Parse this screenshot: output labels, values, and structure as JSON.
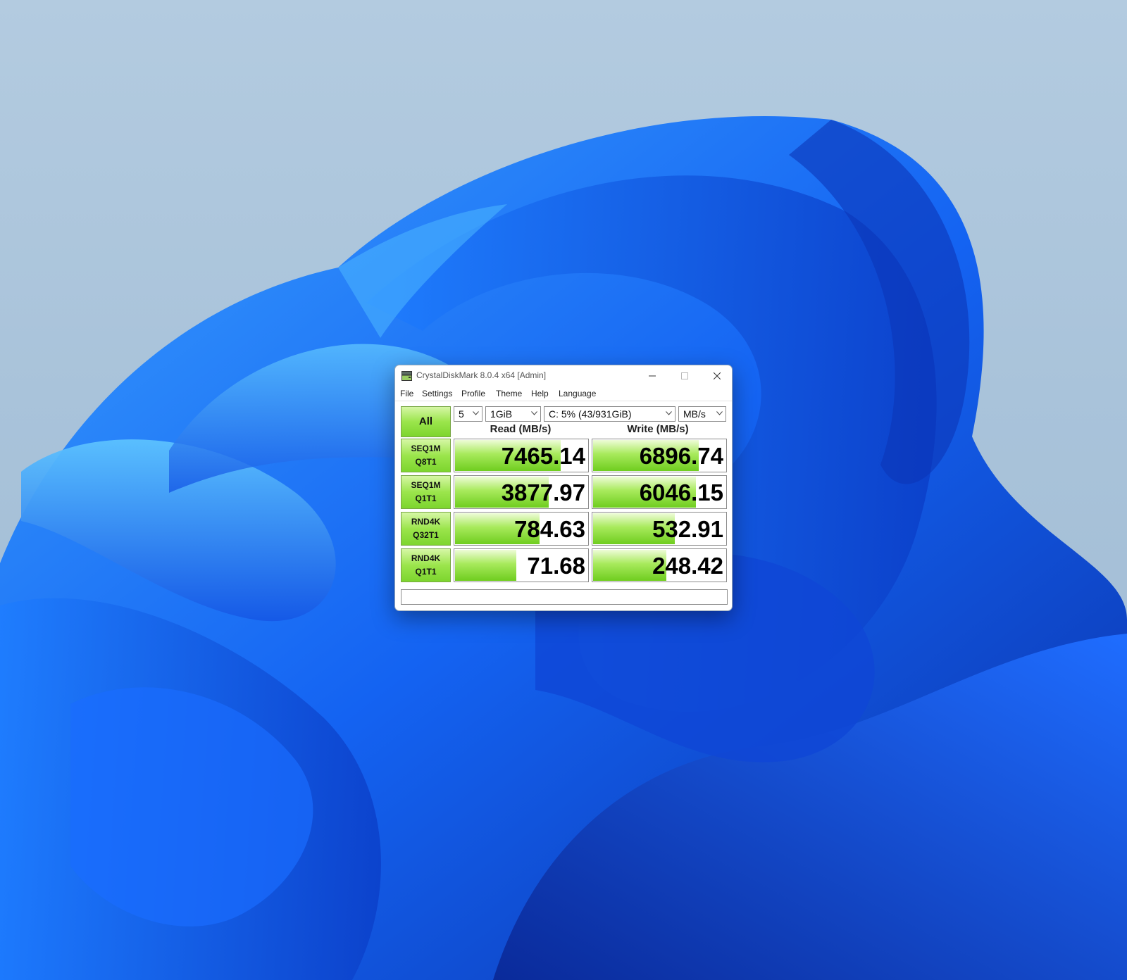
{
  "window": {
    "title": "CrystalDiskMark 8.0.4 x64 [Admin]",
    "controls": {
      "minimize": "minimize-icon",
      "maximize": "maximize-icon",
      "close": "close-icon"
    }
  },
  "menu": [
    "File",
    "Settings",
    "Profile",
    "Theme",
    "Help",
    "Language"
  ],
  "toolbar": {
    "all_label": "All",
    "count": "5",
    "size": "1GiB",
    "drive": "C: 5% (43/931GiB)",
    "unit": "MB/s"
  },
  "headers": {
    "read": "Read (MB/s)",
    "write": "Write (MB/s)"
  },
  "tests": [
    {
      "line1": "SEQ1M",
      "line2": "Q8T1",
      "read": "7465.14",
      "write": "6896.74",
      "read_fill": 0.8,
      "write_fill": 0.8
    },
    {
      "line1": "SEQ1M",
      "line2": "Q1T1",
      "read": "3877.97",
      "write": "6046.15",
      "read_fill": 0.71,
      "write_fill": 0.78
    },
    {
      "line1": "RND4K",
      "line2": "Q32T1",
      "read": "784.63",
      "write": "532.91",
      "read_fill": 0.64,
      "write_fill": 0.62
    },
    {
      "line1": "RND4K",
      "line2": "Q1T1",
      "read": "71.68",
      "write": "248.42",
      "read_fill": 0.47,
      "write_fill": 0.56
    }
  ],
  "status_text": "",
  "colors": {
    "bar_green": "#7dd52e",
    "button_green": "#9be54c",
    "wallpaper_blue": "#1a5cff"
  }
}
